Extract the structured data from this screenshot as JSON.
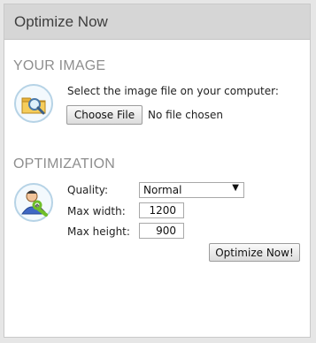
{
  "header": {
    "title": "Optimize Now"
  },
  "image_section": {
    "heading": "YOUR IMAGE",
    "icon": "folder-search-icon",
    "instruction": "Select the image file on your computer:",
    "choose_file_label": "Choose File",
    "file_status": "No file chosen"
  },
  "optimization_section": {
    "heading": "OPTIMIZATION",
    "icon": "user-wrench-icon",
    "quality": {
      "label": "Quality:",
      "value": "Normal"
    },
    "max_width": {
      "label": "Max width:",
      "value": "1200"
    },
    "max_height": {
      "label": "Max height:",
      "value": "900"
    },
    "submit_label": "Optimize Now!"
  },
  "colors": {
    "header_bg": "#d6d6d6",
    "section_heading": "#8e8e8e",
    "icon_ring": "#b6d3e6"
  }
}
